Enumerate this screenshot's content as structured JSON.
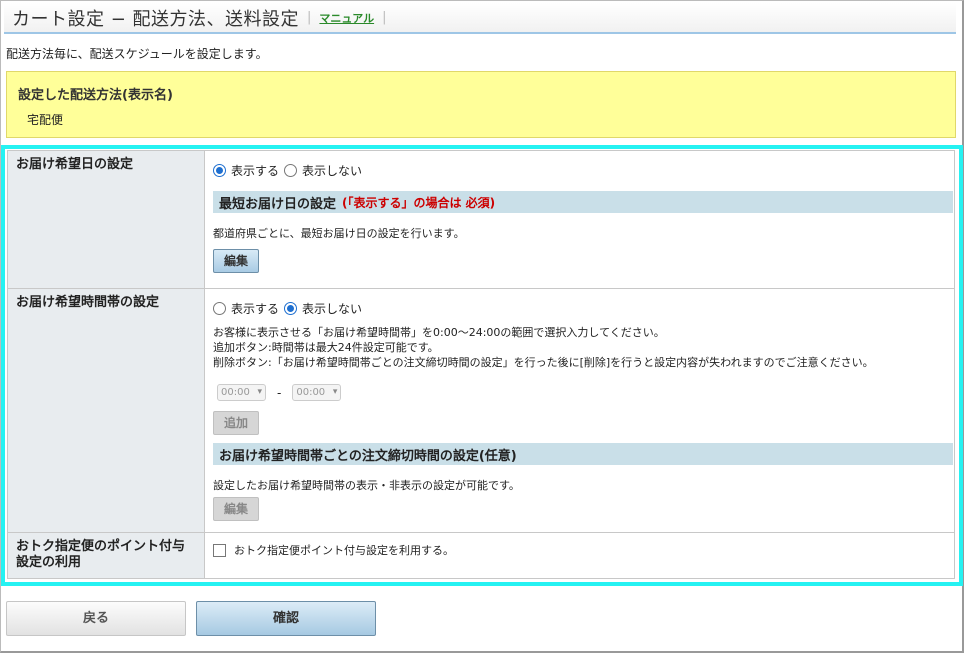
{
  "header": {
    "title": "カート設定 − 配送方法、送料設定",
    "manual_link": "マニュアル"
  },
  "description": "配送方法毎に、配送スケジュールを設定します。",
  "notice": {
    "title": "設定した配送方法(表示名)",
    "value": "宅配便"
  },
  "sections": {
    "delivery_date": {
      "label": "お届け希望日の設定",
      "option_show": "表示する",
      "option_hide": "表示しない",
      "selected": "show",
      "subhead": "最短お届け日の設定",
      "subhead_required": "(「表示する」の場合は 必須)",
      "text": "都道府県ごとに、最短お届け日の設定を行います。",
      "edit_label": "編集"
    },
    "delivery_time": {
      "label": "お届け希望時間帯の設定",
      "option_show": "表示する",
      "option_hide": "表示しない",
      "selected": "hide",
      "text1": "お客様に表示させる「お届け希望時間帯」を0:00〜24:00の範囲で選択入力してください。",
      "text2": "追加ボタン:時間帯は最大24件設定可能です。",
      "text3": "削除ボタン:「お届け希望時間帯ごとの注文締切時間の設定」を行った後に[削除]を行うと設定内容が失われますのでご注意ください。",
      "from_value": "00:00",
      "range_dash": "-",
      "to_value": "00:00",
      "add_label": "追加",
      "subhead": "お届け希望時間帯ごとの注文締切時間の設定(任意)",
      "subhead_text": "設定したお届け希望時間帯の表示・非表示の設定が可能です。",
      "edit_label": "編集"
    },
    "point": {
      "label": "おトク指定便のポイント付与設定の利用",
      "checkbox_label": "おトク指定便ポイント付与設定を利用する。",
      "checked": false
    }
  },
  "footer": {
    "back_label": "戻る",
    "confirm_label": "確認"
  }
}
